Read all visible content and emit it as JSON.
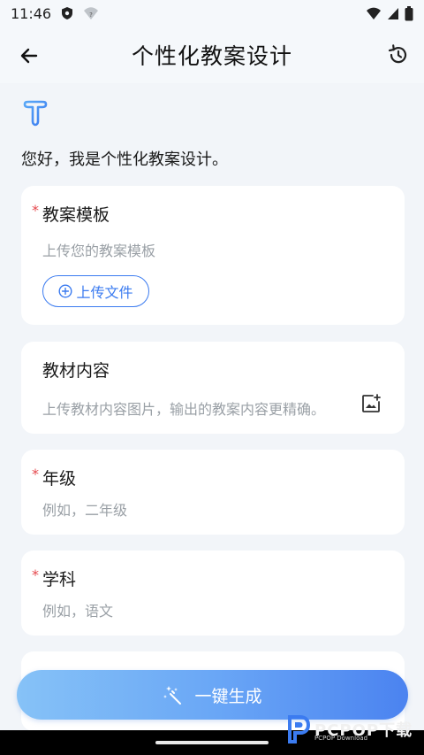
{
  "status_bar": {
    "time": "11:46",
    "icons": [
      "shield-icon",
      "wifi-question-icon",
      "wifi-icon",
      "signal-icon",
      "battery-icon"
    ]
  },
  "header": {
    "title": "个性化教案设计",
    "back_icon": "arrow-left-icon",
    "history_icon": "history-icon"
  },
  "greeting": "您好，我是个性化教案设计。",
  "cards": {
    "template": {
      "label": "教案模板",
      "required_mark": "*",
      "hint": "上传您的教案模板",
      "upload_label": "上传文件"
    },
    "material": {
      "label": "教材内容",
      "hint": "上传教材内容图片，输出的教案内容更精确。"
    },
    "grade": {
      "label": "年级",
      "required_mark": "*",
      "placeholder": "例如，二年级"
    },
    "subject": {
      "label": "学科",
      "required_mark": "*",
      "placeholder": "例如，语文"
    }
  },
  "generate_button": {
    "label": "一键生成",
    "icon": "magic-wand-icon"
  },
  "watermark": {
    "text": "PCPOP下载",
    "sub": "PCPOP Download"
  },
  "colors": {
    "accent": "#3b7bf0",
    "required": "#e5484d",
    "background": "#f2f5f9"
  }
}
